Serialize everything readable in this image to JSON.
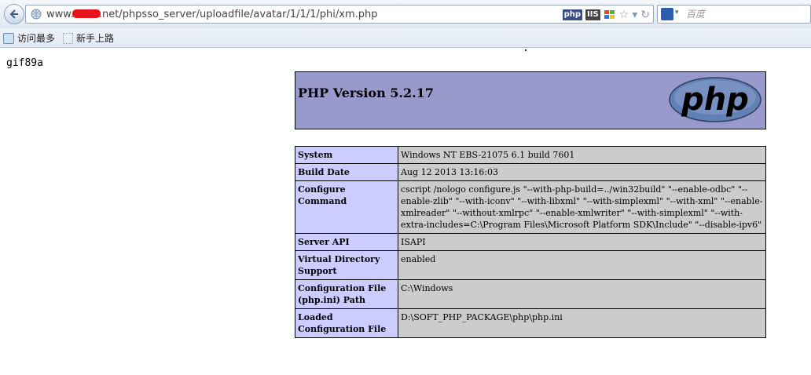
{
  "browser": {
    "url_prefix": "www.",
    "url_suffix": ".net/phpsso_server/uploadfile/avatar/1/1/1/phi/xm.php",
    "badges": [
      "php",
      "IIS"
    ],
    "search": {
      "placeholder": "百度"
    },
    "bookmarks": [
      "访问最多",
      "新手上路"
    ]
  },
  "page": {
    "prefix_text": "gif89a",
    "php_version_title": "PHP Version 5.2.17",
    "logo_text": "php",
    "rows": [
      {
        "key": "System",
        "value": "Windows NT EBS-21075 6.1 build 7601"
      },
      {
        "key": "Build Date",
        "value": "Aug 12 2013 13:16:03"
      },
      {
        "key": "Configure Command",
        "value": "cscript /nologo configure.js \"--with-php-build=../win32build\" \"--enable-odbc\" \"--enable-zlib\" \"--with-iconv\" \"--with-libxml\" \"--with-simplexml\" \"--with-xml\" \"--enable-xmlreader\" \"--without-xmlrpc\" \"--enable-xmlwriter\" \"--with-simplexml\" \"--with-extra-includes=C:\\Program Files\\Microsoft Platform SDK\\Include\" \"--disable-ipv6\""
      },
      {
        "key": "Server API",
        "value": "ISAPI"
      },
      {
        "key": "Virtual Directory Support",
        "value": "enabled"
      },
      {
        "key": "Configuration File (php.ini) Path",
        "value": "C:\\Windows"
      },
      {
        "key": "Loaded Configuration File",
        "value": "D:\\SOFT_PHP_PACKAGE\\php\\php.ini"
      }
    ]
  },
  "colors": {
    "header_bg": "#9999cc",
    "key_bg": "#ccccff",
    "value_bg": "#cccccc",
    "logo_blue": "#6181b6"
  }
}
